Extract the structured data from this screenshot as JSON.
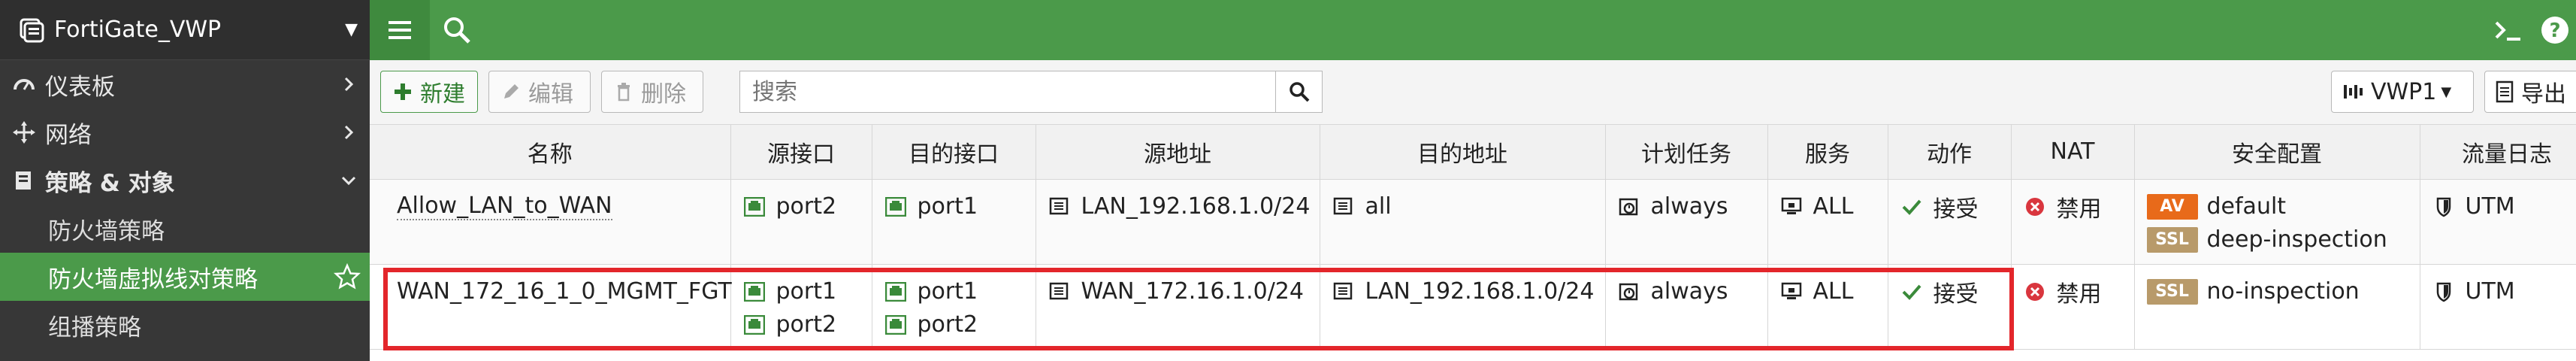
{
  "sidebar": {
    "device_name": "FortiGate_VWP",
    "items": [
      {
        "label": "仪表板",
        "icon": "dashboard-icon"
      },
      {
        "label": "网络",
        "icon": "network-icon"
      },
      {
        "label": "策略 & 对象",
        "icon": "policy-icon"
      },
      {
        "label": "防火墙策略"
      },
      {
        "label": "防火墙虚拟线对策略"
      },
      {
        "label": "组播策略"
      }
    ]
  },
  "toolbar": {
    "new_label": "新建",
    "edit_label": "编辑",
    "delete_label": "删除",
    "search_placeholder": "搜索",
    "vdom_label": "VWP1",
    "export_label": "导出"
  },
  "table": {
    "headers": [
      "名称",
      "源接口",
      "目的接口",
      "源地址",
      "目的地址",
      "计划任务",
      "服务",
      "动作",
      "NAT",
      "安全配置",
      "流量日志"
    ],
    "rows": [
      {
        "name": "Allow_LAN_to_WAN",
        "src_intf": [
          "port2"
        ],
        "dst_intf": [
          "port1"
        ],
        "src_addr": "LAN_192.168.1.0/24",
        "dst_addr": "all",
        "schedule": "always",
        "service": "ALL",
        "action": "接受",
        "nat": "禁用",
        "security": [
          {
            "tag": "AV",
            "value": "default"
          },
          {
            "tag": "SSL",
            "value": "deep-inspection"
          }
        ],
        "log": "UTM"
      },
      {
        "name": "WAN_172_16_1_0_MGMT_FGT",
        "src_intf": [
          "port1",
          "port2"
        ],
        "dst_intf": [
          "port1",
          "port2"
        ],
        "src_addr": "WAN_172.16.1.0/24",
        "dst_addr": "LAN_192.168.1.0/24",
        "schedule": "always",
        "service": "ALL",
        "action": "接受",
        "nat": "禁用",
        "security": [
          {
            "tag": "SSL",
            "value": "no-inspection"
          }
        ],
        "log": "UTM"
      }
    ]
  },
  "colors": {
    "accent": "#4b9a4a",
    "highlight_border": "#e3262b",
    "deny": "#d9363e",
    "av_tag": "#e86a1a",
    "ssl_tag": "#b89a6a"
  }
}
